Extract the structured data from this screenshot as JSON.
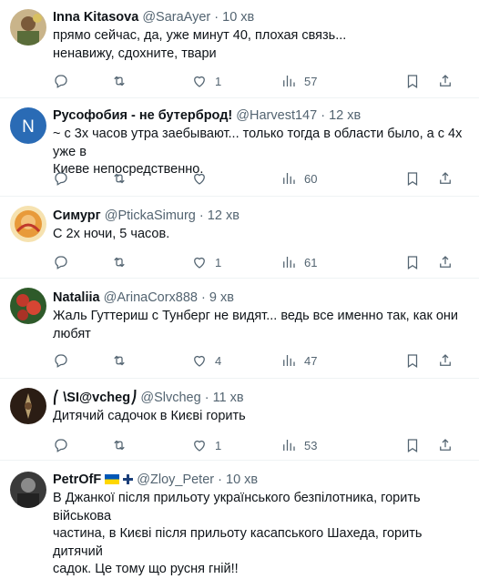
{
  "tweets": [
    {
      "name": "Inna Kitasova",
      "handle": "@SaraAyer",
      "dot": "·",
      "time": "10 хв",
      "lines": [
        "прямо сейчас, да, уже минут 40, плохая связь...",
        "ненавижу, сдохните, твари"
      ],
      "likes": "1",
      "views": "57",
      "avatar": "avatar-image"
    },
    {
      "name": "Русофобия - не бутерброд!",
      "handle": "@Harvest147",
      "dot": "·",
      "time": "12 хв",
      "lines": [
        "~ с 3х часов утра заебывают... только тогда в области было, а с 4х уже в",
        "Киеве непосредственно."
      ],
      "likes": "",
      "views": "60",
      "avatar_letter": "N",
      "avatar_color": "#2a6bb5"
    },
    {
      "name": "Симург",
      "handle": "@PtickaSimurg",
      "dot": "·",
      "time": "12 хв",
      "lines": [
        "С 2х ночи, 5 часов."
      ],
      "likes": "1",
      "views": "61",
      "avatar": "avatar-image"
    },
    {
      "name": "Nataliia",
      "handle": "@ArinaCorx888",
      "dot": "·",
      "time": "9 хв",
      "lines": [
        "Жаль Гуттериш с Тунберг не видят... ведь все именно так, как они",
        "любят"
      ],
      "likes": "4",
      "views": "47",
      "avatar": "avatar-image"
    },
    {
      "name": "⎛ \\SI@vcheg⎠",
      "handle": "@Slvcheg",
      "dot": "·",
      "time": "11 хв",
      "lines": [
        "Дитячий садочок в Києві горить"
      ],
      "likes": "1",
      "views": "53",
      "avatar": "avatar-image"
    },
    {
      "name": "PetrOfF",
      "handle": "@Zloy_Peter",
      "dot": "·",
      "time": "10 хв",
      "lines": [
        "В Джанкої після прильоту українського безпілотника, горить військова",
        "частина, в Києві після прильоту касапського Шахеда, горить дитячий",
        "садок. Це тому що русня гнiй!!"
      ],
      "avatar": "avatar-image"
    }
  ],
  "colors": {
    "text": "#0f1419",
    "muted": "#536471",
    "divider": "#eff3f4"
  }
}
